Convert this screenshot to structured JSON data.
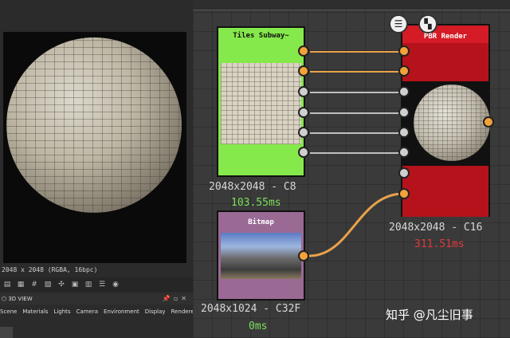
{
  "viewport": {
    "resolution_text": "2048 x 2048 (RGBA, 16bpc)"
  },
  "panel": {
    "title": "3D VIEW",
    "menu": [
      "Scene",
      "Materials",
      "Lights",
      "Camera",
      "Environment",
      "Display",
      "Renderer"
    ]
  },
  "nodes": {
    "tiles": {
      "title": "Tiles Subway~",
      "size": "2048x2048 - C8",
      "time": "103.55ms"
    },
    "bitmap": {
      "title": "Bitmap",
      "size": "2048x1024 - C32F",
      "time": "0ms"
    },
    "render": {
      "title": "PBR Render",
      "size": "2048x2048 - C16",
      "time": "311.51ms"
    }
  },
  "watermark": "知乎 @凡尘旧事",
  "colors": {
    "tiles_node": "#85e84b",
    "bitmap_node": "#9a6a95",
    "render_node": "#b5121b",
    "wire_active": "#e9a24a",
    "time_green": "#7be05a",
    "time_red": "#e23a3a"
  }
}
